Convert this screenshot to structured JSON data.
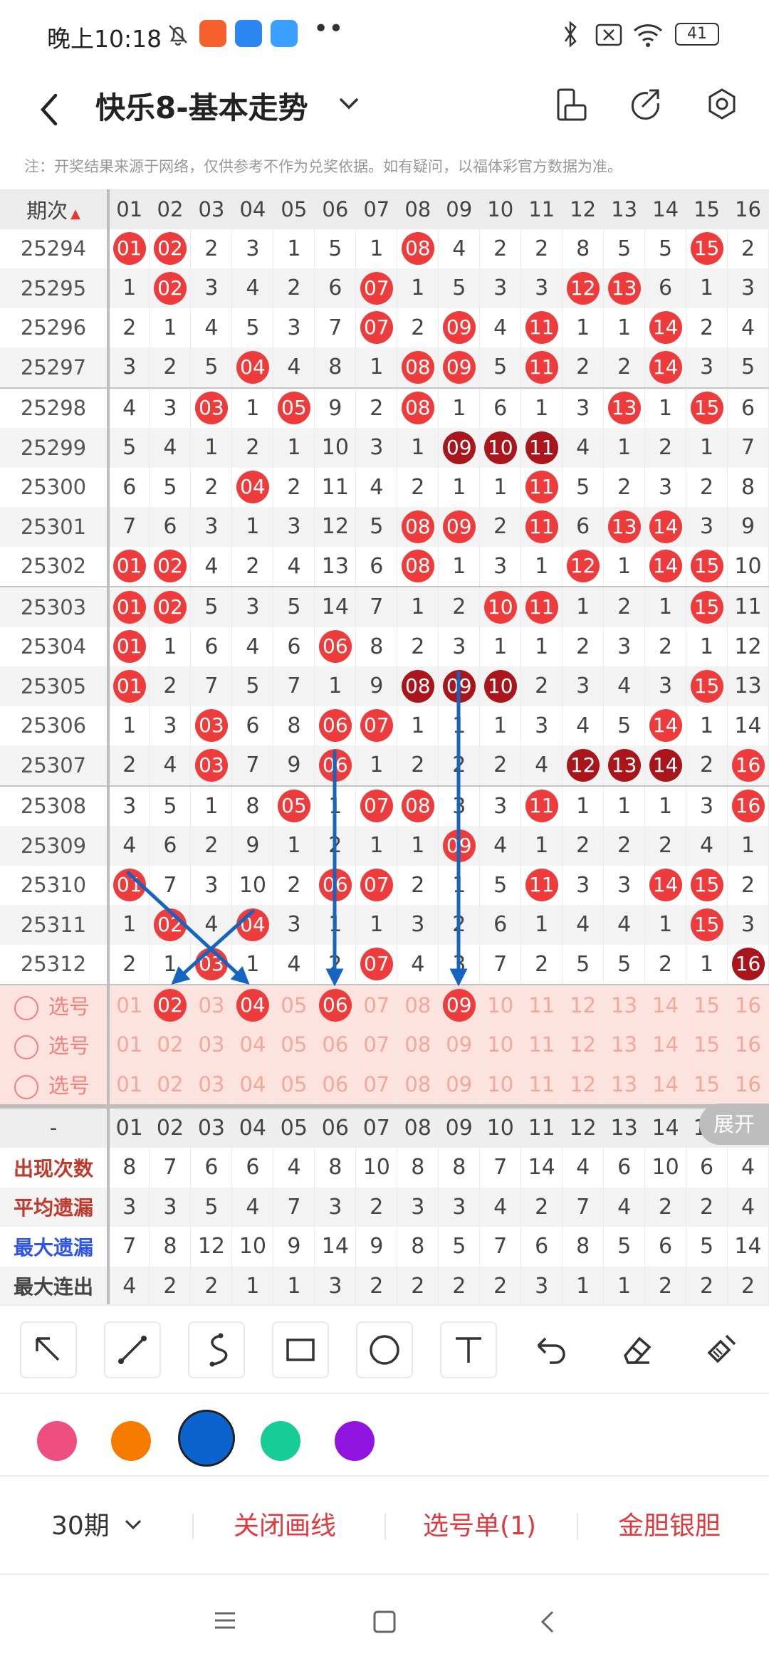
{
  "status": {
    "time": "晚上10:18",
    "battery": "41"
  },
  "header": {
    "title": "快乐8-基本走势"
  },
  "notice": "注：开奖结果来源于网络，仅供参考不作为兑奖依据。如有疑问，以福体彩官方数据为准。",
  "grid": {
    "issue_header": "期次",
    "columns": [
      "01",
      "02",
      "03",
      "04",
      "05",
      "06",
      "07",
      "08",
      "09",
      "10",
      "11",
      "12",
      "13",
      "14",
      "15",
      "16"
    ],
    "rows": [
      {
        "issue": "25294",
        "cells": [
          {
            "v": "01",
            "b": "r"
          },
          {
            "v": "02",
            "b": "r"
          },
          {
            "v": "2"
          },
          {
            "v": "3"
          },
          {
            "v": "1"
          },
          {
            "v": "5"
          },
          {
            "v": "1"
          },
          {
            "v": "08",
            "b": "r"
          },
          {
            "v": "4"
          },
          {
            "v": "2"
          },
          {
            "v": "2"
          },
          {
            "v": "8"
          },
          {
            "v": "5"
          },
          {
            "v": "5"
          },
          {
            "v": "15",
            "b": "r"
          },
          {
            "v": "2"
          }
        ]
      },
      {
        "issue": "25295",
        "cells": [
          {
            "v": "1"
          },
          {
            "v": "02",
            "b": "r"
          },
          {
            "v": "3"
          },
          {
            "v": "4"
          },
          {
            "v": "2"
          },
          {
            "v": "6"
          },
          {
            "v": "07",
            "b": "r"
          },
          {
            "v": "1"
          },
          {
            "v": "5"
          },
          {
            "v": "3"
          },
          {
            "v": "3"
          },
          {
            "v": "12",
            "b": "r"
          },
          {
            "v": "13",
            "b": "r"
          },
          {
            "v": "6"
          },
          {
            "v": "1"
          },
          {
            "v": "3"
          }
        ]
      },
      {
        "issue": "25296",
        "cells": [
          {
            "v": "2"
          },
          {
            "v": "1"
          },
          {
            "v": "4"
          },
          {
            "v": "5"
          },
          {
            "v": "3"
          },
          {
            "v": "7"
          },
          {
            "v": "07",
            "b": "r"
          },
          {
            "v": "2"
          },
          {
            "v": "09",
            "b": "r"
          },
          {
            "v": "4"
          },
          {
            "v": "11",
            "b": "r"
          },
          {
            "v": "1"
          },
          {
            "v": "1"
          },
          {
            "v": "14",
            "b": "r"
          },
          {
            "v": "2"
          },
          {
            "v": "4"
          }
        ]
      },
      {
        "issue": "25297",
        "cells": [
          {
            "v": "3"
          },
          {
            "v": "2"
          },
          {
            "v": "5"
          },
          {
            "v": "04",
            "b": "r"
          },
          {
            "v": "4"
          },
          {
            "v": "8"
          },
          {
            "v": "1"
          },
          {
            "v": "08",
            "b": "r"
          },
          {
            "v": "09",
            "b": "r"
          },
          {
            "v": "5"
          },
          {
            "v": "11",
            "b": "r"
          },
          {
            "v": "2"
          },
          {
            "v": "2"
          },
          {
            "v": "14",
            "b": "r"
          },
          {
            "v": "3"
          },
          {
            "v": "5"
          }
        ]
      },
      {
        "issue": "25298",
        "cells": [
          {
            "v": "4"
          },
          {
            "v": "3"
          },
          {
            "v": "03",
            "b": "r"
          },
          {
            "v": "1"
          },
          {
            "v": "05",
            "b": "r"
          },
          {
            "v": "9"
          },
          {
            "v": "2"
          },
          {
            "v": "08",
            "b": "r"
          },
          {
            "v": "1"
          },
          {
            "v": "6"
          },
          {
            "v": "1"
          },
          {
            "v": "3"
          },
          {
            "v": "13",
            "b": "r"
          },
          {
            "v": "1"
          },
          {
            "v": "15",
            "b": "r"
          },
          {
            "v": "6"
          }
        ]
      },
      {
        "issue": "25299",
        "cells": [
          {
            "v": "5"
          },
          {
            "v": "4"
          },
          {
            "v": "1"
          },
          {
            "v": "2"
          },
          {
            "v": "1"
          },
          {
            "v": "10"
          },
          {
            "v": "3"
          },
          {
            "v": "1"
          },
          {
            "v": "09",
            "b": "d"
          },
          {
            "v": "10",
            "b": "d"
          },
          {
            "v": "11",
            "b": "d"
          },
          {
            "v": "4"
          },
          {
            "v": "1"
          },
          {
            "v": "2"
          },
          {
            "v": "1"
          },
          {
            "v": "7"
          }
        ]
      },
      {
        "issue": "25300",
        "cells": [
          {
            "v": "6"
          },
          {
            "v": "5"
          },
          {
            "v": "2"
          },
          {
            "v": "04",
            "b": "r"
          },
          {
            "v": "2"
          },
          {
            "v": "11"
          },
          {
            "v": "4"
          },
          {
            "v": "2"
          },
          {
            "v": "1"
          },
          {
            "v": "1"
          },
          {
            "v": "11",
            "b": "r"
          },
          {
            "v": "5"
          },
          {
            "v": "2"
          },
          {
            "v": "3"
          },
          {
            "v": "2"
          },
          {
            "v": "8"
          }
        ]
      },
      {
        "issue": "25301",
        "cells": [
          {
            "v": "7"
          },
          {
            "v": "6"
          },
          {
            "v": "3"
          },
          {
            "v": "1"
          },
          {
            "v": "3"
          },
          {
            "v": "12"
          },
          {
            "v": "5"
          },
          {
            "v": "08",
            "b": "r"
          },
          {
            "v": "09",
            "b": "r"
          },
          {
            "v": "2"
          },
          {
            "v": "11",
            "b": "r"
          },
          {
            "v": "6"
          },
          {
            "v": "13",
            "b": "r"
          },
          {
            "v": "14",
            "b": "r"
          },
          {
            "v": "3"
          },
          {
            "v": "9"
          }
        ]
      },
      {
        "issue": "25302",
        "cells": [
          {
            "v": "01",
            "b": "r"
          },
          {
            "v": "02",
            "b": "r"
          },
          {
            "v": "4"
          },
          {
            "v": "2"
          },
          {
            "v": "4"
          },
          {
            "v": "13"
          },
          {
            "v": "6"
          },
          {
            "v": "08",
            "b": "r"
          },
          {
            "v": "1"
          },
          {
            "v": "3"
          },
          {
            "v": "1"
          },
          {
            "v": "12",
            "b": "r"
          },
          {
            "v": "1"
          },
          {
            "v": "14",
            "b": "r"
          },
          {
            "v": "15",
            "b": "r"
          },
          {
            "v": "10"
          }
        ]
      },
      {
        "issue": "25303",
        "cells": [
          {
            "v": "01",
            "b": "r"
          },
          {
            "v": "02",
            "b": "r"
          },
          {
            "v": "5"
          },
          {
            "v": "3"
          },
          {
            "v": "5"
          },
          {
            "v": "14"
          },
          {
            "v": "7"
          },
          {
            "v": "1"
          },
          {
            "v": "2"
          },
          {
            "v": "10",
            "b": "r"
          },
          {
            "v": "11",
            "b": "r"
          },
          {
            "v": "1"
          },
          {
            "v": "2"
          },
          {
            "v": "1"
          },
          {
            "v": "15",
            "b": "r"
          },
          {
            "v": "11"
          }
        ]
      },
      {
        "issue": "25304",
        "cells": [
          {
            "v": "01",
            "b": "r"
          },
          {
            "v": "1"
          },
          {
            "v": "6"
          },
          {
            "v": "4"
          },
          {
            "v": "6"
          },
          {
            "v": "06",
            "b": "r"
          },
          {
            "v": "8"
          },
          {
            "v": "2"
          },
          {
            "v": "3"
          },
          {
            "v": "1"
          },
          {
            "v": "1"
          },
          {
            "v": "2"
          },
          {
            "v": "3"
          },
          {
            "v": "2"
          },
          {
            "v": "1"
          },
          {
            "v": "12"
          }
        ]
      },
      {
        "issue": "25305",
        "cells": [
          {
            "v": "01",
            "b": "r"
          },
          {
            "v": "2"
          },
          {
            "v": "7"
          },
          {
            "v": "5"
          },
          {
            "v": "7"
          },
          {
            "v": "1"
          },
          {
            "v": "9"
          },
          {
            "v": "08",
            "b": "d"
          },
          {
            "v": "09",
            "b": "d"
          },
          {
            "v": "10",
            "b": "d"
          },
          {
            "v": "2"
          },
          {
            "v": "3"
          },
          {
            "v": "4"
          },
          {
            "v": "3"
          },
          {
            "v": "15",
            "b": "r"
          },
          {
            "v": "13"
          }
        ]
      },
      {
        "issue": "25306",
        "cells": [
          {
            "v": "1"
          },
          {
            "v": "3"
          },
          {
            "v": "03",
            "b": "r"
          },
          {
            "v": "6"
          },
          {
            "v": "8"
          },
          {
            "v": "06",
            "b": "r"
          },
          {
            "v": "07",
            "b": "r"
          },
          {
            "v": "1"
          },
          {
            "v": "1"
          },
          {
            "v": "1"
          },
          {
            "v": "3"
          },
          {
            "v": "4"
          },
          {
            "v": "5"
          },
          {
            "v": "14",
            "b": "r"
          },
          {
            "v": "1"
          },
          {
            "v": "14"
          }
        ]
      },
      {
        "issue": "25307",
        "cells": [
          {
            "v": "2"
          },
          {
            "v": "4"
          },
          {
            "v": "03",
            "b": "r"
          },
          {
            "v": "7"
          },
          {
            "v": "9"
          },
          {
            "v": "06",
            "b": "r"
          },
          {
            "v": "1"
          },
          {
            "v": "2"
          },
          {
            "v": "2"
          },
          {
            "v": "2"
          },
          {
            "v": "4"
          },
          {
            "v": "12",
            "b": "d"
          },
          {
            "v": "13",
            "b": "d"
          },
          {
            "v": "14",
            "b": "d"
          },
          {
            "v": "2"
          },
          {
            "v": "16",
            "b": "r"
          }
        ]
      },
      {
        "issue": "25308",
        "cells": [
          {
            "v": "3"
          },
          {
            "v": "5"
          },
          {
            "v": "1"
          },
          {
            "v": "8"
          },
          {
            "v": "05",
            "b": "r"
          },
          {
            "v": "1"
          },
          {
            "v": "07",
            "b": "r"
          },
          {
            "v": "08",
            "b": "r"
          },
          {
            "v": "3"
          },
          {
            "v": "3"
          },
          {
            "v": "11",
            "b": "r"
          },
          {
            "v": "1"
          },
          {
            "v": "1"
          },
          {
            "v": "1"
          },
          {
            "v": "3"
          },
          {
            "v": "16",
            "b": "r"
          }
        ]
      },
      {
        "issue": "25309",
        "cells": [
          {
            "v": "4"
          },
          {
            "v": "6"
          },
          {
            "v": "2"
          },
          {
            "v": "9"
          },
          {
            "v": "1"
          },
          {
            "v": "2"
          },
          {
            "v": "1"
          },
          {
            "v": "1"
          },
          {
            "v": "09",
            "b": "r"
          },
          {
            "v": "4"
          },
          {
            "v": "1"
          },
          {
            "v": "2"
          },
          {
            "v": "2"
          },
          {
            "v": "2"
          },
          {
            "v": "4"
          },
          {
            "v": "1"
          }
        ]
      },
      {
        "issue": "25310",
        "cells": [
          {
            "v": "01",
            "b": "r"
          },
          {
            "v": "7"
          },
          {
            "v": "3"
          },
          {
            "v": "10"
          },
          {
            "v": "2"
          },
          {
            "v": "06",
            "b": "r"
          },
          {
            "v": "07",
            "b": "r"
          },
          {
            "v": "2"
          },
          {
            "v": "1"
          },
          {
            "v": "5"
          },
          {
            "v": "11",
            "b": "r"
          },
          {
            "v": "3"
          },
          {
            "v": "3"
          },
          {
            "v": "14",
            "b": "r"
          },
          {
            "v": "15",
            "b": "r"
          },
          {
            "v": "2"
          }
        ]
      },
      {
        "issue": "25311",
        "cells": [
          {
            "v": "1"
          },
          {
            "v": "02",
            "b": "r"
          },
          {
            "v": "4"
          },
          {
            "v": "04",
            "b": "r"
          },
          {
            "v": "3"
          },
          {
            "v": "1"
          },
          {
            "v": "1"
          },
          {
            "v": "3"
          },
          {
            "v": "2"
          },
          {
            "v": "6"
          },
          {
            "v": "1"
          },
          {
            "v": "4"
          },
          {
            "v": "4"
          },
          {
            "v": "1"
          },
          {
            "v": "15",
            "b": "r"
          },
          {
            "v": "3"
          }
        ]
      },
      {
        "issue": "25312",
        "cells": [
          {
            "v": "2"
          },
          {
            "v": "1"
          },
          {
            "v": "03",
            "b": "r"
          },
          {
            "v": "1"
          },
          {
            "v": "4"
          },
          {
            "v": "2"
          },
          {
            "v": "07",
            "b": "r"
          },
          {
            "v": "4"
          },
          {
            "v": "3"
          },
          {
            "v": "7"
          },
          {
            "v": "2"
          },
          {
            "v": "5"
          },
          {
            "v": "5"
          },
          {
            "v": "2"
          },
          {
            "v": "1"
          },
          {
            "v": "16",
            "b": "d"
          }
        ]
      }
    ],
    "pick_label": "选号",
    "pick_rows": [
      {
        "selected": [
          "02",
          "04",
          "06",
          "09"
        ]
      },
      {
        "selected": []
      },
      {
        "selected": []
      }
    ],
    "stats_header": "-",
    "stats": [
      {
        "label": "出现次数",
        "tone": "red",
        "values": [
          "8",
          "7",
          "6",
          "6",
          "4",
          "8",
          "10",
          "8",
          "8",
          "7",
          "14",
          "4",
          "6",
          "10",
          "6",
          "4"
        ]
      },
      {
        "label": "平均遗漏",
        "tone": "red",
        "values": [
          "3",
          "3",
          "5",
          "4",
          "7",
          "3",
          "2",
          "3",
          "3",
          "4",
          "2",
          "7",
          "4",
          "2",
          "2",
          "4"
        ]
      },
      {
        "label": "最大遗漏",
        "tone": "blue",
        "values": [
          "7",
          "8",
          "12",
          "10",
          "9",
          "14",
          "9",
          "8",
          "5",
          "7",
          "6",
          "8",
          "5",
          "6",
          "5",
          "14"
        ]
      },
      {
        "label": "最大连出",
        "tone": "dark",
        "values": [
          "4",
          "2",
          "2",
          "1",
          "1",
          "3",
          "2",
          "2",
          "2",
          "2",
          "3",
          "1",
          "1",
          "2",
          "2",
          "2"
        ]
      }
    ]
  },
  "expand_label": "展开",
  "tools": [
    "arrow-tool",
    "line-tool",
    "curve-tool",
    "rectangle-tool",
    "circle-tool",
    "text-tool",
    "undo-tool",
    "eraser-tool",
    "clear-tool"
  ],
  "palette": [
    "#ee4d7f",
    "#f57c00",
    "#0b63ce",
    "#18cc98",
    "#8f14e0"
  ],
  "actions": {
    "period": "30期",
    "close_draw": "关闭画线",
    "pick_list": "选号单(1)",
    "golden": "金胆银胆"
  }
}
